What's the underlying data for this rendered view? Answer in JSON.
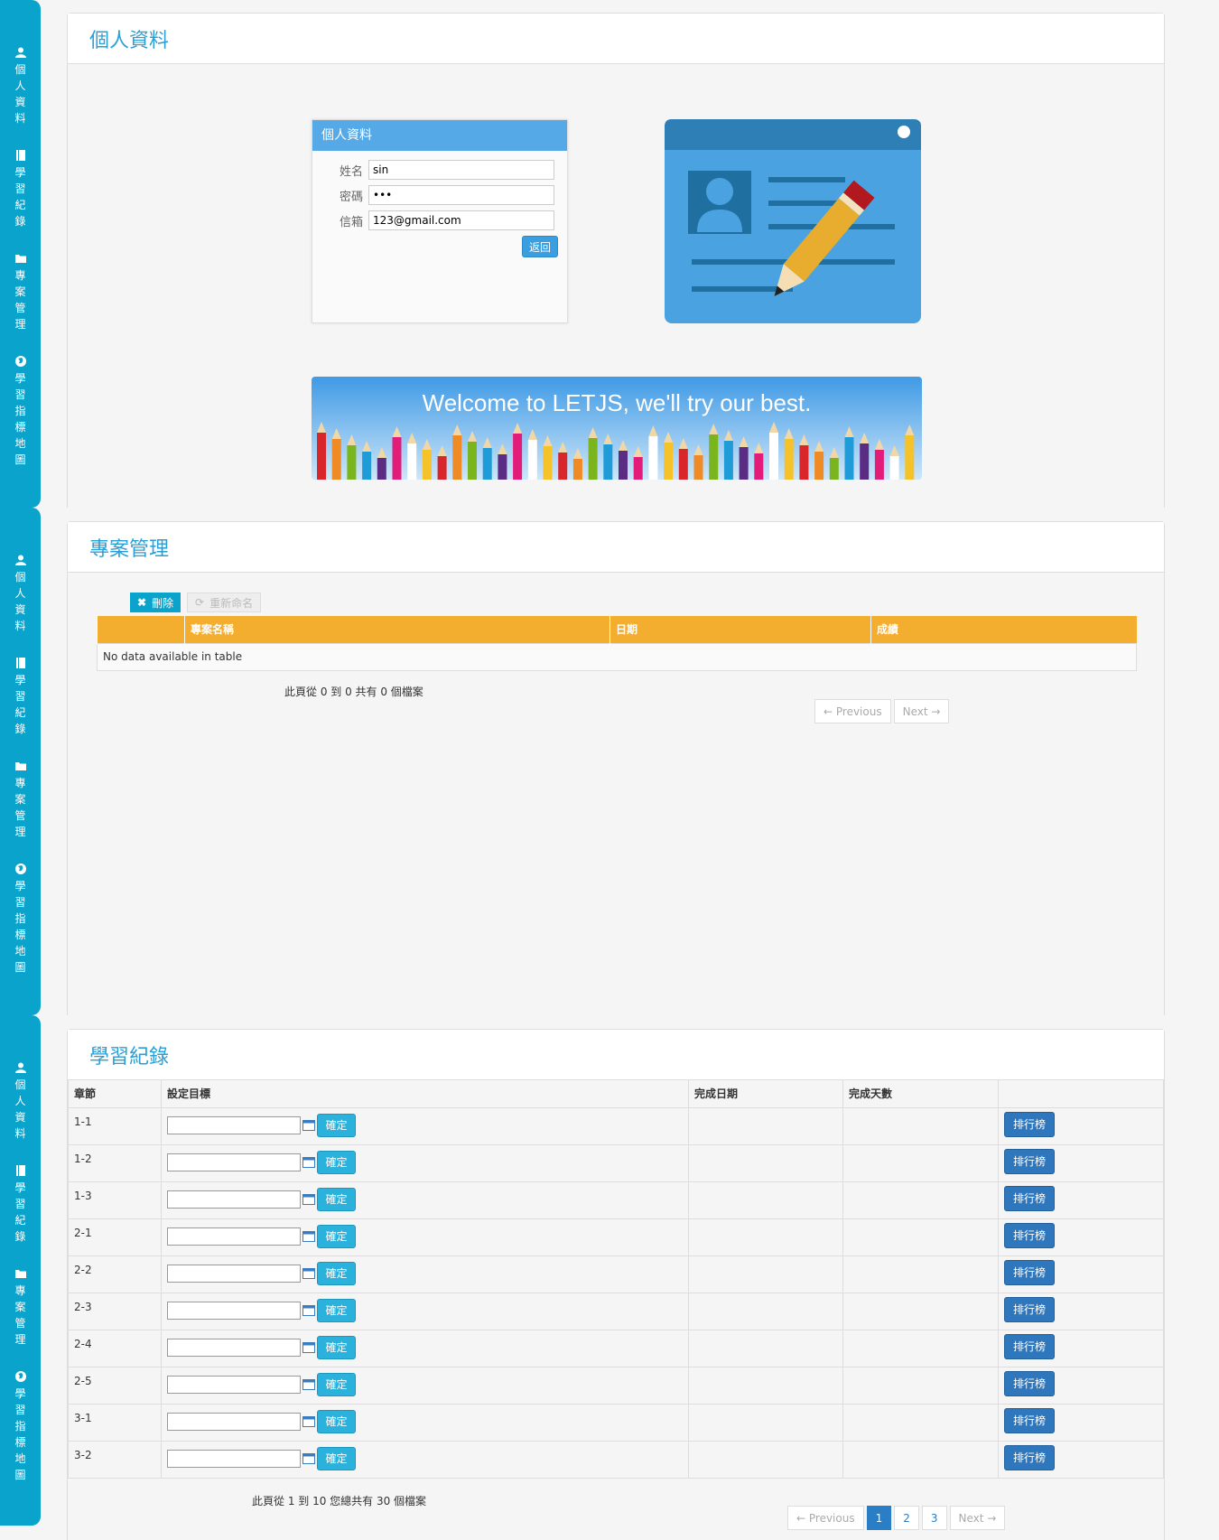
{
  "sidebar": {
    "items": [
      {
        "label": "個人資料",
        "icon": "user-icon"
      },
      {
        "label": "學習紀錄",
        "icon": "book-icon"
      },
      {
        "label": "專案管理",
        "icon": "folder-icon"
      },
      {
        "label": "學習指標地圖",
        "icon": "globe-icon"
      }
    ]
  },
  "profile_section": {
    "title": "個人資料",
    "card": {
      "title": "個人資料",
      "name_label": "姓名",
      "name_value": "sin",
      "password_label": "密碼",
      "password_value": "•••",
      "email_label": "信箱",
      "email_value": "123@gmail.com",
      "back_button": "返回"
    },
    "banner_text": "Welcome to LETJS, we'll try our best."
  },
  "project_section": {
    "title": "專案管理",
    "delete_button": "刪除",
    "rename_button": "重新命名",
    "columns": [
      "",
      "專案名稱",
      "日期",
      "成績"
    ],
    "empty_text": "No data available in table",
    "info_text": "此頁從 0 到 0 共有 0 個檔案",
    "prev_label": "← Previous",
    "next_label": "Next →"
  },
  "learning_section": {
    "title": "學習紀錄",
    "columns": [
      "章節",
      "設定目標",
      "完成日期",
      "完成天數",
      ""
    ],
    "confirm_label": "確定",
    "rank_label": "排行榜",
    "rows": [
      {
        "chapter": "1-1"
      },
      {
        "chapter": "1-2"
      },
      {
        "chapter": "1-3"
      },
      {
        "chapter": "2-1"
      },
      {
        "chapter": "2-2"
      },
      {
        "chapter": "2-3"
      },
      {
        "chapter": "2-4"
      },
      {
        "chapter": "2-5"
      },
      {
        "chapter": "3-1"
      },
      {
        "chapter": "3-2"
      }
    ],
    "info_text": "此頁從 1 到 10 您總共有 30 個檔案",
    "prev_label": "← Previous",
    "next_label": "Next →",
    "pages": [
      "1",
      "2",
      "3"
    ],
    "active_page": "1"
  },
  "colors": {
    "sidebar": "#0aa3cc",
    "title": "#2a9fd6",
    "table_header": "#f4ae2f",
    "rank_button": "#2f77bd",
    "confirm_button": "#2bb2dc"
  }
}
